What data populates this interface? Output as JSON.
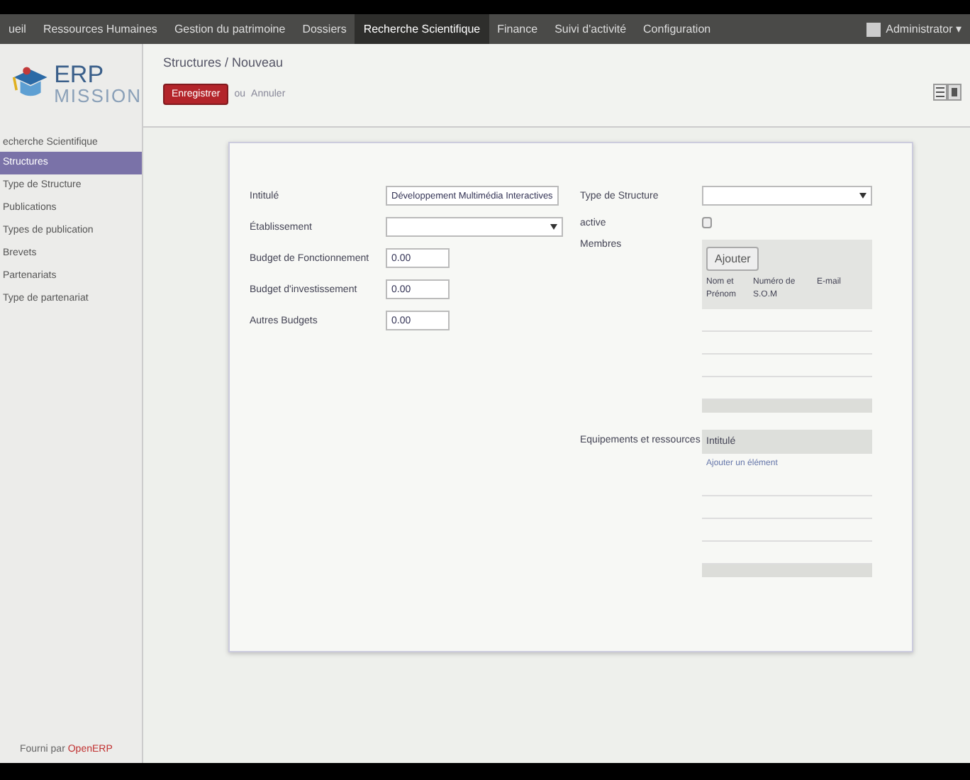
{
  "top_menu": [
    {
      "label": "ueil",
      "selected": false
    },
    {
      "label": "Ressources Humaines",
      "selected": false
    },
    {
      "label": "Gestion du patrimoine",
      "selected": false
    },
    {
      "label": "Dossiers",
      "selected": false
    },
    {
      "label": "Recherche Scientifique",
      "selected": true
    },
    {
      "label": "Finance",
      "selected": false
    },
    {
      "label": "Suivi d'activité",
      "selected": false
    },
    {
      "label": "Configuration",
      "selected": false
    }
  ],
  "user": {
    "name": "Administrator ▾"
  },
  "logo": {
    "line1": "ERP",
    "line2": "MISSION"
  },
  "sidebar": {
    "header": "echerche Scientifique",
    "items": [
      {
        "label": "Structures",
        "selected": true
      },
      {
        "label": "Type de Structure",
        "selected": false
      },
      {
        "label": "Publications",
        "selected": false
      },
      {
        "label": "Types de publication",
        "selected": false
      },
      {
        "label": "Brevets",
        "selected": false
      },
      {
        "label": "Partenariats",
        "selected": false
      },
      {
        "label": "Type de partenariat",
        "selected": false
      }
    ],
    "footer": {
      "text": "Fourni par",
      "link": "OpenERP"
    }
  },
  "breadcrumb": "Structures / Nouveau",
  "actions": {
    "save": "Enregistrer",
    "or": "ou",
    "cancel": "Annuler"
  },
  "form": {
    "left_fields": [
      {
        "label": "Intitulé",
        "kind": "text",
        "value": "Développement Multimédia Interactives"
      },
      {
        "label": "Établissement",
        "kind": "select"
      },
      {
        "label": "Budget de Fonctionnement",
        "kind": "number",
        "value": "0.00"
      },
      {
        "label": "Budget d'investissement",
        "kind": "number",
        "value": "0.00"
      },
      {
        "label": "Autres Budgets",
        "kind": "number",
        "value": "0.00"
      }
    ],
    "type_label": "Type de Structure",
    "active": {
      "label": "active",
      "checked": false
    },
    "members": {
      "label": "Membres",
      "add": "Ajouter",
      "columns": [
        "Nom et Prénom",
        "Numéro de S.O.M",
        "E-mail"
      ]
    },
    "equipment": {
      "label": "Equipements et ressources",
      "columns": [
        "Intitulé"
      ],
      "add": "Ajouter un élément"
    }
  }
}
